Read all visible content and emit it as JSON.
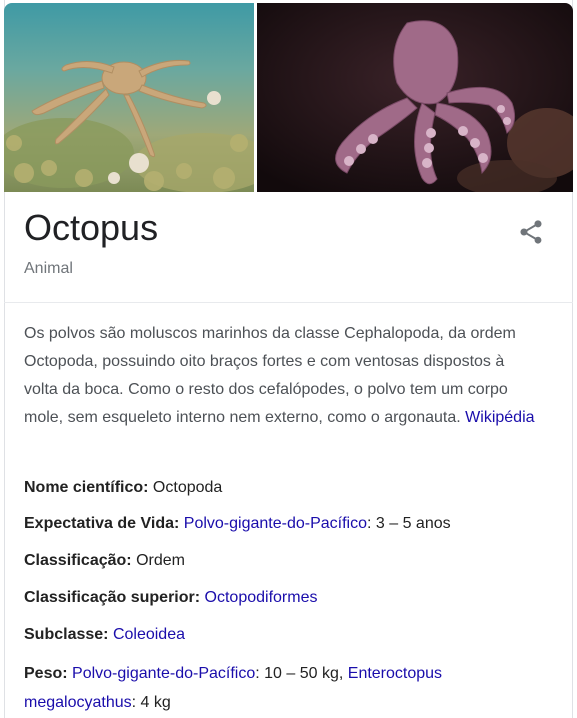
{
  "knowledge_panel": {
    "title": "Octopus",
    "subtitle": "Animal",
    "description": "Os polvos são moluscos marinhos da classe Cephalopoda, da ordem Octopoda, possuindo oito braços fortes e com ventosas dispostos à volta da boca. Como o resto dos cefalópodes, o polvo tem um corpo mole, sem esqueleto interno nem externo, como o argonauta.",
    "source_link": "Wikipédia",
    "share_icon": "share-icon"
  },
  "facts": {
    "scientific_name": {
      "label": "Nome científico:",
      "value": "Octopoda"
    },
    "life_expectancy": {
      "label": "Expectativa de Vida:",
      "link": "Polvo-gigante-do-Pacífico",
      "value": ": 3 – 5 anos"
    },
    "classification": {
      "label": "Classificação:",
      "value": "Ordem"
    },
    "superior": {
      "label": "Classificação superior:",
      "link": "Octopodiformes"
    },
    "subclass": {
      "label": "Subclasse:",
      "link": "Coleoidea"
    },
    "weight": {
      "label": "Peso:",
      "link1": "Polvo-gigante-do-Pacífico",
      "mid": ": 10 – 50 kg, ",
      "link2a": "Enteroctopus",
      "link2b": "megalocyathus",
      "tail": ": 4 kg"
    }
  },
  "colors": {
    "link": "#1a0dab",
    "text": "#222222",
    "muted": "#70757a"
  }
}
